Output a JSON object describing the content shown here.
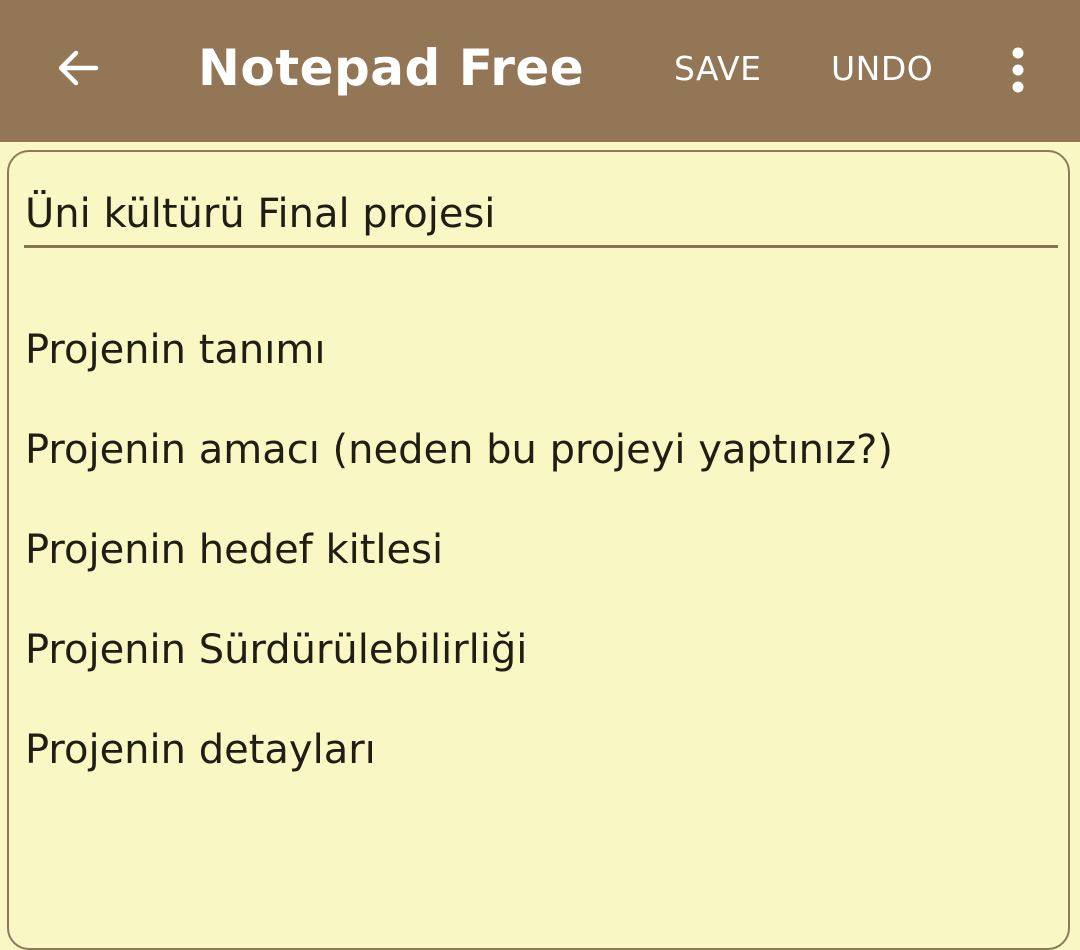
{
  "app_bar": {
    "title": "Notepad Free",
    "back_icon": "arrow-left-icon",
    "save_label": "SAVE",
    "undo_label": "UNDO",
    "more_icon": "more-vertical-icon"
  },
  "note": {
    "title": "Üni kültürü Final projesi",
    "lines": [
      "Projenin tanımı",
      "Projenin amacı (neden bu projeyi yaptınız?)",
      "Projenin hedef kitlesi",
      "Projenin Sürdürülebilirliği",
      "Projenin detayları"
    ]
  },
  "colors": {
    "app_bar": "#927656",
    "paper": "#f9f8c4",
    "text": "#1f1d14",
    "border": "#8c7a5c"
  }
}
